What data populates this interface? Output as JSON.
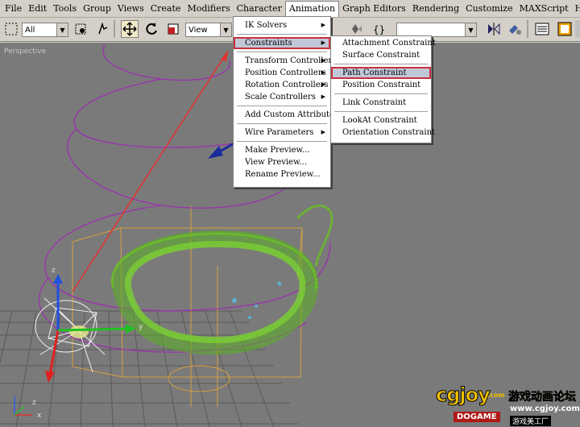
{
  "menubar": {
    "items": [
      "File",
      "Edit",
      "Tools",
      "Group",
      "Views",
      "Create",
      "Modifiers",
      "Character",
      "Animation",
      "Graph Editors",
      "Rendering",
      "Customize",
      "MAXScript",
      "Help"
    ],
    "active_index": 8
  },
  "toolbar": {
    "selection_filter": "All",
    "reference_coord": "View",
    "icons": [
      "select-region-icon",
      "select-object-icon",
      "select-by-name-icon",
      "move-icon",
      "rotate-icon",
      "scale-icon",
      "mirror-icon",
      "align-icon",
      "curve-editor-icon",
      "material-editor-icon"
    ]
  },
  "viewport": {
    "label": "Perspective"
  },
  "animation_menu": {
    "items": [
      {
        "label": "IK Solvers",
        "submenu": true
      },
      {
        "label": "Constraints",
        "submenu": true,
        "highlighted": true
      },
      {
        "label": "Transform Controllers",
        "submenu": true
      },
      {
        "label": "Position Controllers",
        "submenu": true
      },
      {
        "label": "Rotation Controllers",
        "submenu": true
      },
      {
        "label": "Scale Controllers",
        "submenu": true
      },
      {
        "label": "Add Custom Attribute",
        "submenu": false
      },
      {
        "label": "Wire Parameters",
        "submenu": true
      },
      {
        "label": "Make Preview...",
        "submenu": false
      },
      {
        "label": "View Preview...",
        "submenu": false
      },
      {
        "label": "Rename Preview...",
        "submenu": false
      }
    ]
  },
  "constraints_menu": {
    "items": [
      {
        "label": "Attachment Constraint"
      },
      {
        "label": "Surface Constraint"
      },
      {
        "label": "Path Constraint",
        "highlighted": true
      },
      {
        "label": "Position Constraint"
      },
      {
        "label": "Link Constraint"
      },
      {
        "label": "LookAt Constraint"
      },
      {
        "label": "Orientation Constraint"
      }
    ]
  },
  "gizmo_labels": {
    "z": "z",
    "y": "y",
    "x": "x"
  },
  "watermark": {
    "brand": "cgjoy",
    "com": ".com",
    "chinese": "游戏动画论坛",
    "url": "www.cgjoy.com",
    "dogame": "DOGAME",
    "tagline": "游戏美工厂"
  },
  "colors": {
    "highlight_box": "#c8323c",
    "path_spiral": "#9b30b0",
    "particles": "#6ac026",
    "arrow_red": "#e83030",
    "arrow_blue": "#1a2b9a"
  }
}
